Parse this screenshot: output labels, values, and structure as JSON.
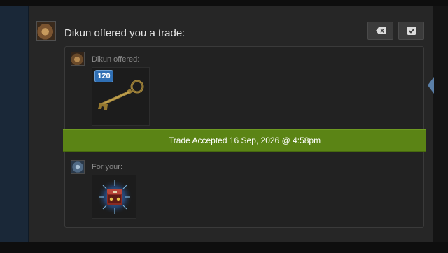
{
  "notification": {
    "title": "Dikun offered you a trade:",
    "colors": {
      "accept_banner": "#5b8415",
      "qty_badge": "#2f6fb4",
      "side_accent": "#5a7fa8"
    }
  },
  "header_actions": {
    "dismiss_icon": "backspace-icon",
    "confirm_icon": "checkbox-check-icon"
  },
  "offer": {
    "label": "Dikun offered:",
    "item": {
      "icon": "key-icon",
      "quantity": "120"
    }
  },
  "status": {
    "text": "Trade Accepted 16 Sep, 2026 @ 4:58pm"
  },
  "request": {
    "label": "For your:",
    "item": {
      "icon": "crate-icon"
    }
  }
}
